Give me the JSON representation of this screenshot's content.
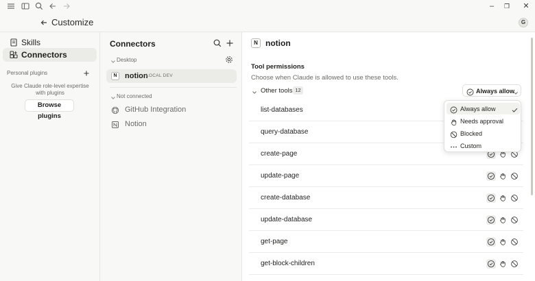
{
  "window": {
    "controls": {
      "minimize": "–",
      "maximize": "❐",
      "close": "✕"
    }
  },
  "header": {
    "title": "Customize",
    "avatar_initial": "G"
  },
  "sidebar": {
    "items": [
      {
        "label": "Skills",
        "icon": "skills-icon",
        "active": false
      },
      {
        "label": "Connectors",
        "icon": "connectors-icon",
        "active": true
      }
    ],
    "personal_plugins_label": "Personal plugins",
    "plugins_description": "Give Claude role-level expertise with plugins",
    "browse_button": "Browse plugins"
  },
  "connectors": {
    "title": "Connectors",
    "desktop_section": "Desktop",
    "desktop_items": [
      {
        "name": "notion",
        "badge": "LOCAL DEV",
        "logo": "N",
        "active": true
      }
    ],
    "not_connected_section": "Not connected",
    "not_connected_items": [
      {
        "name": "GitHub Integration",
        "icon": "github-icon"
      },
      {
        "name": "Notion",
        "icon": "notion-icon"
      }
    ]
  },
  "detail": {
    "logo": "N",
    "title": "notion",
    "permissions_heading": "Tool permissions",
    "permissions_subtitle": "Choose when Claude is allowed to use these tools.",
    "group_label": "Other tools",
    "group_count": "12",
    "dropdown_value": "Always allow",
    "dropdown_options": [
      {
        "label": "Always allow",
        "icon": "check-circle-icon",
        "selected": true
      },
      {
        "label": "Needs approval",
        "icon": "hand-icon",
        "selected": false
      },
      {
        "label": "Blocked",
        "icon": "blocked-icon",
        "selected": false
      },
      {
        "label": "Custom",
        "icon": "more-dots-icon",
        "selected": false
      }
    ],
    "tools": [
      "list-databases",
      "query-database",
      "create-page",
      "update-page",
      "create-database",
      "update-database",
      "get-page",
      "get-block-children"
    ]
  },
  "colors": {
    "background": "#f8f8f7",
    "panel": "#ffffff",
    "border": "#e6e6e2",
    "text": "#1f1f1d",
    "muted": "#6b6b66"
  }
}
